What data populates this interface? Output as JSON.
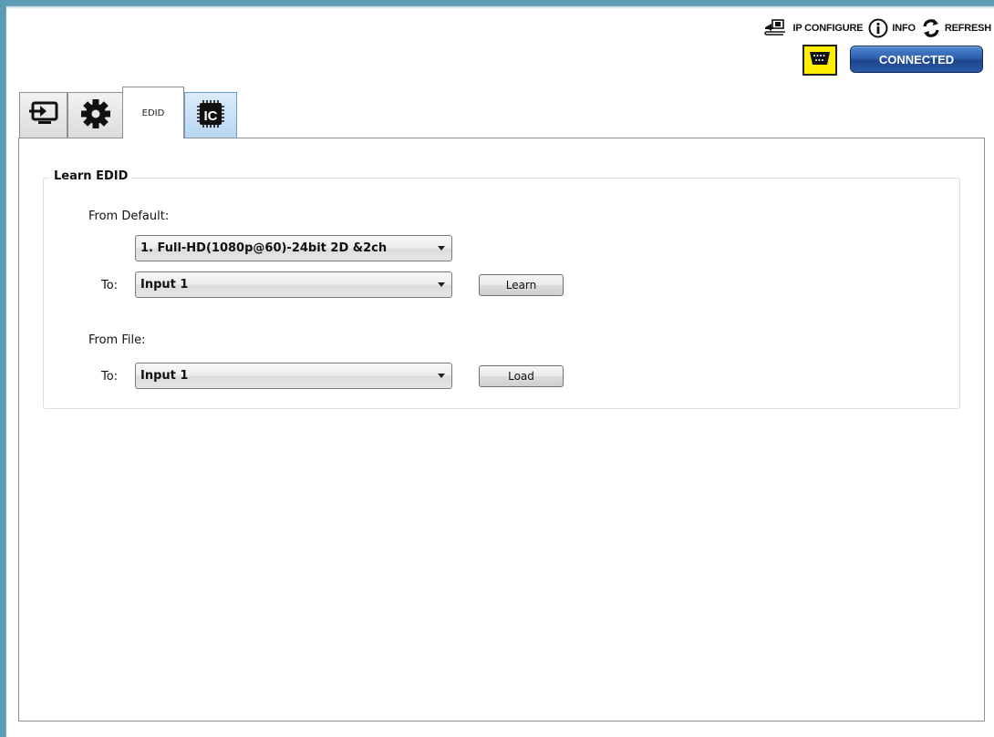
{
  "toolbar": {
    "ip_configure": {
      "label": "IP CONFIGURE",
      "icon": "network-config-icon"
    },
    "info": {
      "label": "INFO",
      "icon": "info-icon"
    },
    "refresh": {
      "label": "REFRESH",
      "icon": "refresh-icon"
    }
  },
  "connection": {
    "serial_icon": "serial-port-icon",
    "serial_color": "#ffee00",
    "status_label": "CONNECTED",
    "status_color": "#2e5fae"
  },
  "tabs": [
    {
      "id": "input",
      "icon": "input-source-icon",
      "label": "",
      "active": false
    },
    {
      "id": "settings",
      "icon": "gear-icon",
      "label": "",
      "active": false
    },
    {
      "id": "edid",
      "icon": "",
      "label": "EDID",
      "active": true
    },
    {
      "id": "ic",
      "icon": "ic-chip-icon",
      "label": "IC",
      "active": false
    }
  ],
  "learn_edid": {
    "title": "Learn EDID",
    "from_default_label": "From Default:",
    "default_select_value": "1. Full-HD(1080p@60)-24bit 2D &2ch",
    "to_label": "To:",
    "to_select_value": "Input 1",
    "learn_button": "Learn",
    "from_file_label": "From File:",
    "file_to_label": "To:",
    "file_to_select_value": "Input 1",
    "load_button": "Load"
  }
}
